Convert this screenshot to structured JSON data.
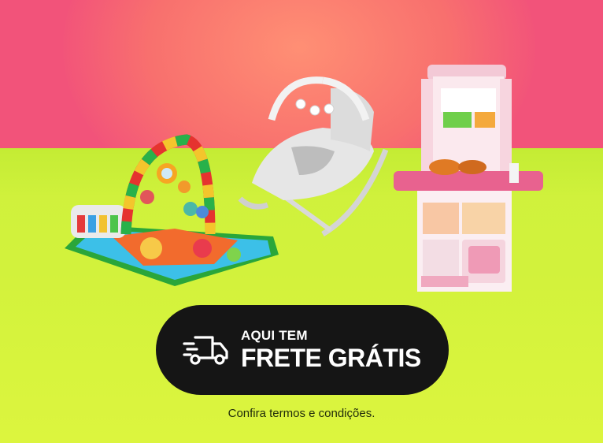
{
  "colors": {
    "top_background": "#f2537a",
    "glow": "#ff8f74",
    "bottom_background": "#d2f23c",
    "button_background": "#151515",
    "button_text": "#ffffff"
  },
  "products": [
    {
      "icon": "baby-play-gym-mat-icon"
    },
    {
      "icon": "baby-bouncer-chair-icon"
    },
    {
      "icon": "toy-kitchen-icon"
    }
  ],
  "cta": {
    "icon": "delivery-truck-icon",
    "line1": "AQUI TEM",
    "line2": "FRETE GRÁTIS"
  },
  "footer": {
    "terms": "Confira termos e condições."
  }
}
